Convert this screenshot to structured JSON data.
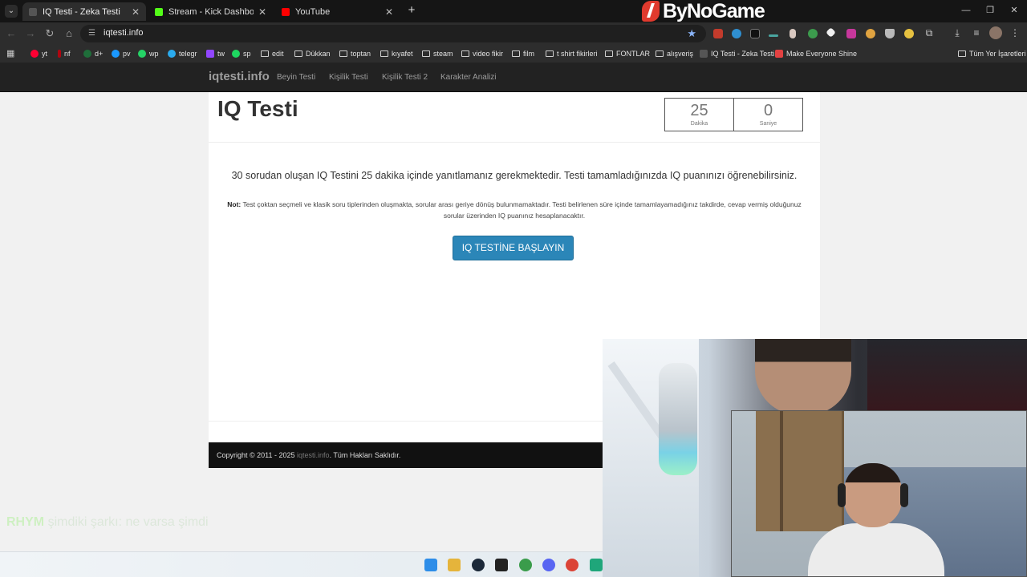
{
  "browser": {
    "tabs": [
      {
        "title": "IQ Testi - Zeka Testi",
        "color": "#555555",
        "active": true
      },
      {
        "title": "Stream - Kick Dashboard",
        "color": "#53fc18",
        "active": false
      },
      {
        "title": "YouTube",
        "color": "#ff0000",
        "active": false
      }
    ],
    "new_tab_label": "+",
    "url": "iqtesti.info",
    "bookmarks": [
      {
        "label": "yt",
        "icon": "youtube-icon",
        "color": "#ff0033"
      },
      {
        "label": "nf",
        "icon": "netflix-icon",
        "color": "#b00610"
      },
      {
        "label": "d+",
        "icon": "disney-icon",
        "color": "#1f6e3a"
      },
      {
        "label": "pv",
        "icon": "prime-icon",
        "color": "#1a98ff"
      },
      {
        "label": "wp",
        "icon": "whatsapp-icon",
        "color": "#25d366"
      },
      {
        "label": "telegr",
        "icon": "telegram-icon",
        "color": "#2aabee"
      },
      {
        "label": "tw",
        "icon": "twitch-icon",
        "color": "#9146ff"
      },
      {
        "label": "sp",
        "icon": "spotify-icon",
        "color": "#1ed760"
      },
      {
        "label": "edit",
        "icon": "folder-icon",
        "color": ""
      },
      {
        "label": "Dükkan",
        "icon": "folder-icon",
        "color": ""
      },
      {
        "label": "toptan",
        "icon": "folder-icon",
        "color": ""
      },
      {
        "label": "kıyafet",
        "icon": "folder-icon",
        "color": ""
      },
      {
        "label": "steam",
        "icon": "folder-icon",
        "color": ""
      },
      {
        "label": "video fikir",
        "icon": "folder-icon",
        "color": ""
      },
      {
        "label": "film",
        "icon": "folder-icon",
        "color": ""
      },
      {
        "label": "t shirt fikirleri",
        "icon": "folder-icon",
        "color": ""
      },
      {
        "label": "FONTLAR",
        "icon": "folder-icon",
        "color": ""
      },
      {
        "label": "alışveriş",
        "icon": "folder-icon",
        "color": ""
      },
      {
        "label": "IQ Testi - Zeka Testi",
        "icon": "iq-site-icon",
        "color": "#555555"
      },
      {
        "label": "Make Everyone Shine",
        "icon": "shine-icon",
        "color": "#e34242"
      }
    ],
    "all_bookmarks_label": "Tüm Yer İşaretleri"
  },
  "overlay": {
    "brand": "ByNoGame",
    "ticker_highlight": "RHYM",
    "ticker_rest": "şimdiki şarkı: ne varsa şimdi"
  },
  "site": {
    "brand": "iqtesti.info",
    "nav": [
      "Beyin Testi",
      "Kişilik Testi",
      "Kişilik Testi 2",
      "Karakter Analizi"
    ],
    "title": "IQ Testi",
    "timer": {
      "minutes": "25",
      "minutes_label": "Dakika",
      "seconds": "0",
      "seconds_label": "Saniye"
    },
    "lead": "30 sorudan oluşan IQ Testini 25 dakika içinde yanıtlamanız gerekmektedir. Testi tamamladığınızda IQ puanınızı öğrenebilirsiniz.",
    "note_label": "Not:",
    "note_text": "Test çoktan seçmeli ve klasik soru tiplerinden oluşmakta, sorular arası geriye dönüş bulunmamaktadır. Testi belirlenen süre içinde tamamlayamadığınız takdirde, cevap vermiş olduğunuz sorular üzerinden IQ puanınız hesaplanacaktır.",
    "start_button": "IQ TESTİNE BAŞLAYIN",
    "footer": {
      "prefix": "Copyright © 2011 - 2025 ",
      "link": "iqtesti.info",
      "suffix": ". Tüm Hakları Saklıdır."
    }
  },
  "colors": {
    "navbar": "#222222",
    "button": "#2b86b8",
    "footer": "#111111",
    "chrome": "#2d2d2d"
  }
}
